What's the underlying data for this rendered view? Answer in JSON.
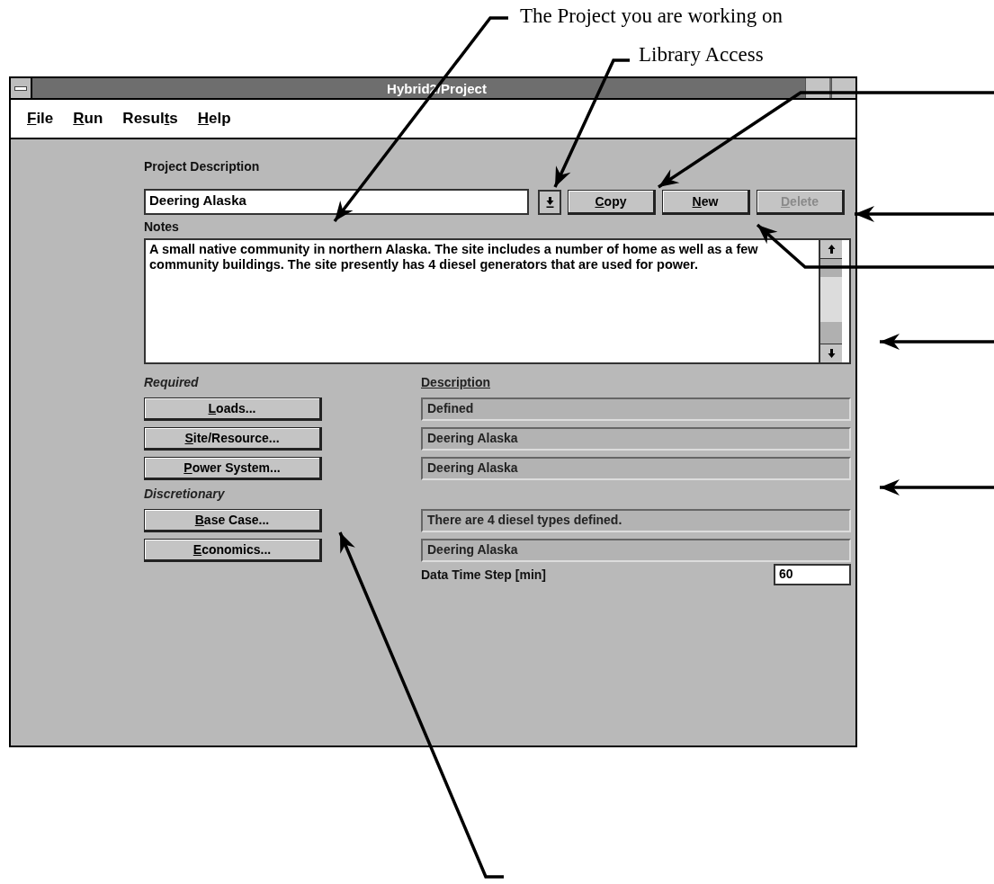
{
  "annotations": [
    {
      "text": "The Project you are working on"
    },
    {
      "text": "Library Access"
    }
  ],
  "window": {
    "title": "Hybrid2/Project"
  },
  "menu": [
    {
      "key": "F",
      "post": "ile"
    },
    {
      "key": "R",
      "post": "un"
    },
    {
      "pre": "Resul",
      "key": "t",
      "post": "s"
    },
    {
      "key": "H",
      "post": "elp"
    }
  ],
  "project": {
    "label": "Project Description",
    "value": "Deering Alaska"
  },
  "actions": [
    {
      "key": "C",
      "post": "opy",
      "disabled": false
    },
    {
      "key": "N",
      "post": "ew",
      "disabled": false
    },
    {
      "key": "D",
      "post": "elete",
      "disabled": true
    }
  ],
  "notes": {
    "label": "Notes",
    "value": "A small native community in northern Alaska.  The site includes a number of home as well as a few community buildings.  The site presently has 4 diesel generators that are used for power."
  },
  "description_header": "Description",
  "groups": [
    {
      "label": "Required",
      "items": [
        {
          "button": {
            "key": "L",
            "post": "oads..."
          },
          "description": "Defined"
        },
        {
          "button": {
            "key": "S",
            "post": "ite/Resource..."
          },
          "description": "Deering Alaska"
        },
        {
          "button": {
            "key": "P",
            "post": "ower System..."
          },
          "description": "Deering Alaska"
        }
      ]
    },
    {
      "label": "Discretionary",
      "items": [
        {
          "button": {
            "key": "B",
            "post": "ase Case..."
          },
          "description": "There are 4 diesel types defined."
        },
        {
          "button": {
            "key": "E",
            "post": "conomics..."
          },
          "description": "Deering Alaska"
        }
      ]
    }
  ],
  "time_step": {
    "label": "Data Time Step [min]",
    "value": "60"
  }
}
